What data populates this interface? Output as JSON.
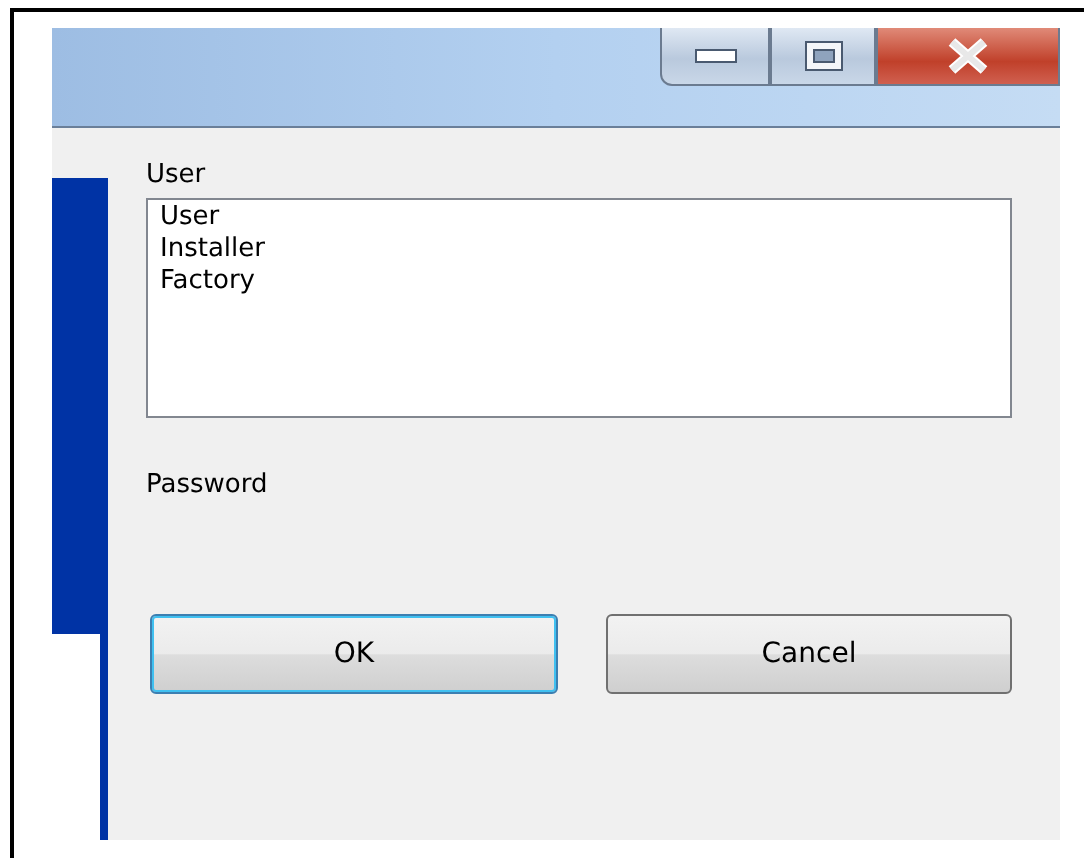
{
  "user_field": {
    "label": "User",
    "options": [
      {
        "label": "User",
        "selected": false
      },
      {
        "label": "Installer",
        "selected": false
      },
      {
        "label": "Factory",
        "selected": false
      }
    ]
  },
  "password_field": {
    "label": "Password"
  },
  "buttons": [
    {
      "label": "OK",
      "focused": true
    },
    {
      "label": "Cancel",
      "focused": false
    }
  ]
}
